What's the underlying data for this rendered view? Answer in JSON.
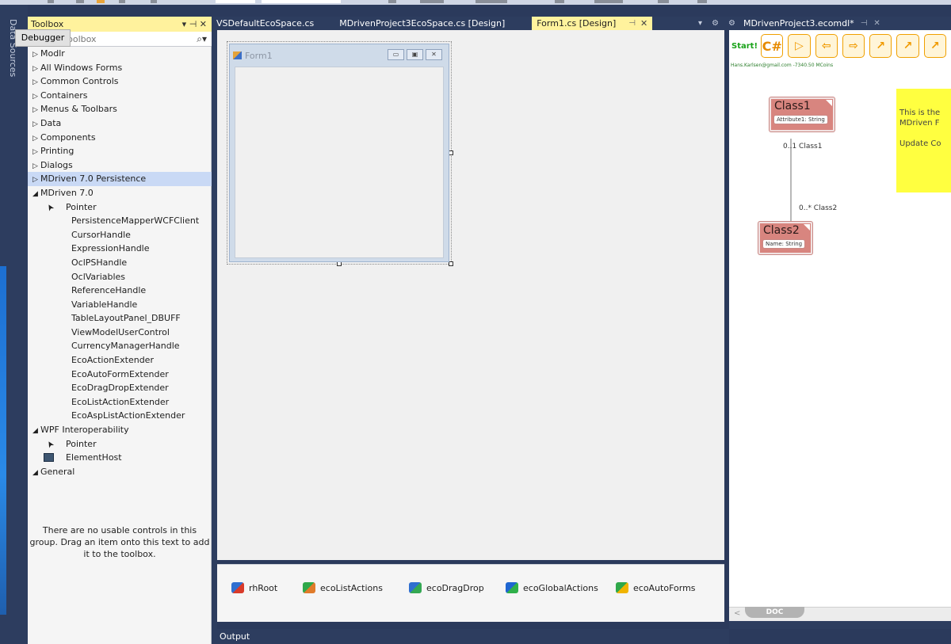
{
  "side_strip": {
    "label": "Data Sources"
  },
  "toolbox": {
    "title": "Toolbox",
    "title_controls": "▾ ⊣ ✕",
    "search_placeholder": "Search Toolbox",
    "search_icon": "search-icon",
    "items": [
      {
        "label": "Modlr",
        "arrow": "▷",
        "level": 0
      },
      {
        "label": "All Windows Forms",
        "arrow": "▷",
        "level": 0
      },
      {
        "label": "Common Controls",
        "arrow": "▷",
        "level": 0
      },
      {
        "label": "Containers",
        "arrow": "▷",
        "level": 0
      },
      {
        "label": "Menus & Toolbars",
        "arrow": "▷",
        "level": 0
      },
      {
        "label": "Data",
        "arrow": "▷",
        "level": 0
      },
      {
        "label": "Components",
        "arrow": "▷",
        "level": 0
      },
      {
        "label": "Printing",
        "arrow": "▷",
        "level": 0
      },
      {
        "label": "Dialogs",
        "arrow": "▷",
        "level": 0
      },
      {
        "label": "MDriven 7.0 Persistence",
        "arrow": "▷",
        "level": 0,
        "selected": true
      },
      {
        "label": "MDriven 7.0",
        "arrow": "◢",
        "level": 0
      },
      {
        "label": "Pointer",
        "level": 1,
        "icon": "pointer-icon"
      },
      {
        "label": "PersistenceMapperWCFClient",
        "level": 2
      },
      {
        "label": "CursorHandle",
        "level": 2
      },
      {
        "label": "ExpressionHandle",
        "level": 2
      },
      {
        "label": "OclPSHandle",
        "level": 2
      },
      {
        "label": "OclVariables",
        "level": 2
      },
      {
        "label": "ReferenceHandle",
        "level": 2
      },
      {
        "label": "VariableHandle",
        "level": 2
      },
      {
        "label": "TableLayoutPanel_DBUFF",
        "level": 2
      },
      {
        "label": "ViewModelUserControl",
        "level": 2
      },
      {
        "label": "CurrencyManagerHandle",
        "level": 2
      },
      {
        "label": "EcoActionExtender",
        "level": 2
      },
      {
        "label": "EcoAutoFormExtender",
        "level": 2
      },
      {
        "label": "EcoDragDropExtender",
        "level": 2
      },
      {
        "label": "EcoListActionExtender",
        "level": 2
      },
      {
        "label": "EcoAspListActionExtender",
        "level": 2
      },
      {
        "label": "WPF Interoperability",
        "arrow": "◢",
        "level": 0
      },
      {
        "label": "Pointer",
        "level": 1,
        "icon": "pointer-icon"
      },
      {
        "label": "ElementHost",
        "level": 1,
        "icon": "element-host-icon"
      },
      {
        "label": "General",
        "arrow": "◢",
        "level": 0
      }
    ],
    "empty_message": "There are no usable controls in this group. Drag an item onto this text to add it to the toolbox."
  },
  "center": {
    "tabs": [
      {
        "label": "VSDefaultEcoSpace.cs",
        "active": false
      },
      {
        "label": "MDrivenProject3EcoSpace.cs [Design]",
        "active": false
      },
      {
        "label": "Form1.cs [Design]",
        "active": true
      }
    ],
    "tab_pin": "⊣",
    "tab_close": "✕",
    "tab_overflow": "▾",
    "tab_settings": "⚙",
    "form": {
      "title": "Form1",
      "button_label": "Debugger",
      "min_btn": "▭",
      "max_btn": "▣",
      "close_btn": "✕"
    },
    "tray": [
      {
        "label": "rhRoot",
        "icon": "root-handle-icon"
      },
      {
        "label": "ecoListActions",
        "icon": "list-actions-icon"
      },
      {
        "label": "ecoDragDrop",
        "icon": "drag-drop-icon"
      },
      {
        "label": "ecoGlobalActions",
        "icon": "global-actions-icon"
      },
      {
        "label": "ecoAutoForms",
        "icon": "auto-forms-icon"
      }
    ]
  },
  "output": {
    "label": "Output"
  },
  "right": {
    "tab_label": "MDrivenProject3.ecomdl*",
    "tab_pin": "⊣",
    "tab_close": "✕",
    "tab_settings": "⚙",
    "toolbar": {
      "start_label": "Start!",
      "buttons": [
        {
          "glyph": "C#",
          "icon": "csharp-icon"
        },
        {
          "glyph": "▷",
          "icon": "play-icon"
        },
        {
          "glyph": "⇦",
          "icon": "arrow-left-icon"
        },
        {
          "glyph": "⇨",
          "icon": "arrow-right-icon"
        },
        {
          "glyph": "↗",
          "icon": "arrow-up-right-icon"
        },
        {
          "glyph": "↗",
          "icon": "arrow-up-right-outline-icon"
        },
        {
          "glyph": "↗",
          "icon": "arrow-dashed-icon"
        }
      ]
    },
    "user_info": "Hans.Karlsen@gmail.com -7340.50 MCoins",
    "classes": [
      {
        "name": "Class1",
        "attribute": "Attribute1: String"
      },
      {
        "name": "Class2",
        "attribute": "Name: String"
      }
    ],
    "roles": {
      "top": "0..1 Class1",
      "bottom": "0..* Class2"
    },
    "note_lines": [
      "This is the",
      "MDriven F",
      "",
      "Update Co"
    ],
    "doc_tab": "DOC",
    "scroll_left": "<"
  },
  "colors": {
    "ide_dark": "#2d3d5f",
    "active_tab": "#fff29d",
    "uml_class": "#d8857f",
    "note_yellow": "#ffff40",
    "toolbar_orange": "#f0a000"
  }
}
